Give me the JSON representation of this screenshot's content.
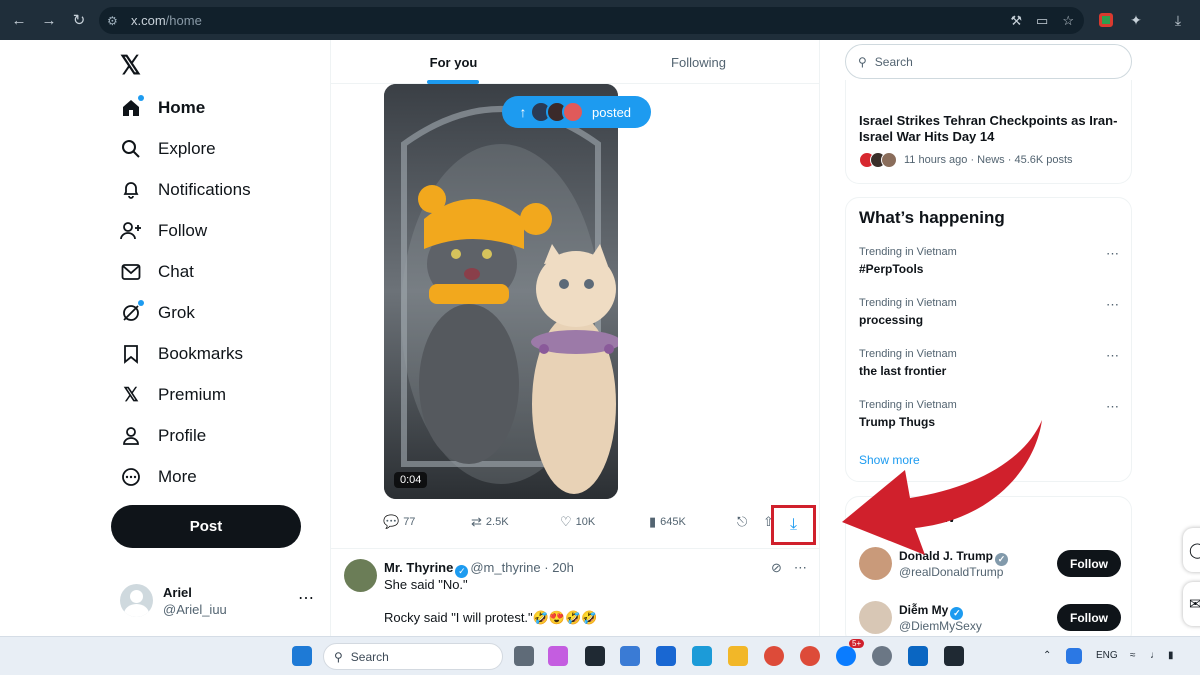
{
  "browser": {
    "url_host": "x.com",
    "url_path": "/home"
  },
  "nav": {
    "items": [
      {
        "label": "Home"
      },
      {
        "label": "Explore"
      },
      {
        "label": "Notifications"
      },
      {
        "label": "Follow"
      },
      {
        "label": "Chat"
      },
      {
        "label": "Grok"
      },
      {
        "label": "Bookmarks"
      },
      {
        "label": "Premium"
      },
      {
        "label": "Profile"
      },
      {
        "label": "More"
      }
    ],
    "post_label": "Post",
    "account": {
      "name": "Ariel",
      "handle": "@Ariel_iuu"
    }
  },
  "feed": {
    "tabs": [
      {
        "label": "For you"
      },
      {
        "label": "Following"
      }
    ],
    "posted_pill": "posted",
    "video_duration": "0:04",
    "actions": {
      "replies": "77",
      "reposts": "2.5K",
      "likes": "10K",
      "views": "645K"
    },
    "tweet2": {
      "name": "Mr. Thyrine",
      "handle": "@m_thyrine",
      "time": "· 20h",
      "line1": "She said \"No.\"",
      "line2": "Rocky said \"I will protest.\"🤣😍🤣🤣"
    }
  },
  "sidebar": {
    "search_placeholder": "Search",
    "news": {
      "title": "Israel Strikes Tehran Checkpoints as Iran-Israel War Hits Day 14",
      "meta": "11 hours ago · News · 45.6K posts"
    },
    "whats_happening": {
      "title": "What’s happening",
      "trends": [
        {
          "context": "Trending in Vietnam",
          "topic": "#PerpTools"
        },
        {
          "context": "Trending in Vietnam",
          "topic": "processing"
        },
        {
          "context": "Trending in Vietnam",
          "topic": "the last frontier"
        },
        {
          "context": "Trending in Vietnam",
          "topic": "Trump Thugs"
        }
      ],
      "show_more": "Show more"
    },
    "who_to_follow": {
      "title_visible": "ollow",
      "users": [
        {
          "name": "Donald J. Trump",
          "handle": "@realDonaldTrump",
          "button": "Follow"
        },
        {
          "name": "Diễm My",
          "handle": "@DiemMySexy",
          "button": "Follow"
        }
      ]
    }
  },
  "taskbar": {
    "search_label": "Search",
    "language": "ENG",
    "mail_badge": "5+"
  },
  "colors": {
    "accent": "#1d9bf0",
    "annotation": "#d0202c",
    "browser_bar": "#1f2e3a"
  }
}
